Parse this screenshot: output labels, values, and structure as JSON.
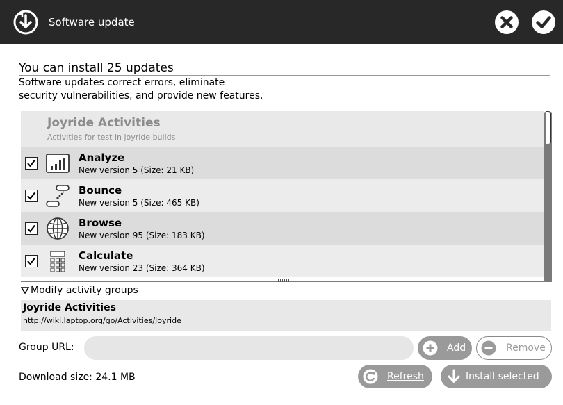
{
  "window": {
    "title": "Software update",
    "app_icon": "download-circle-icon",
    "cancel_icon": "cancel-x-icon",
    "ok_icon": "checkmark-icon"
  },
  "header": {
    "heading": "You can install 25 updates",
    "description_line1": "Software updates correct errors, eliminate",
    "description_line2": "security vulnerabilities, and provide new features."
  },
  "updates": {
    "group": {
      "name": "Joyride Activities",
      "description": "Activities for test in joyride builds"
    },
    "items": [
      {
        "name": "Analyze",
        "version": "New version 5 (Size: 21 KB)",
        "checked": true,
        "icon": "analyze-chart-icon"
      },
      {
        "name": "Bounce",
        "version": "New version 5 (Size: 465 KB)",
        "checked": true,
        "icon": "bounce-icon"
      },
      {
        "name": "Browse",
        "version": "New version 95 (Size: 183 KB)",
        "checked": true,
        "icon": "browse-globe-icon"
      },
      {
        "name": "Calculate",
        "version": "New version 23 (Size: 364 KB)",
        "checked": true,
        "icon": "calculate-icon"
      }
    ]
  },
  "groups": {
    "expander_label": "Modify activity groups",
    "selected_name": "Joyride Activities",
    "selected_url": "http://wiki.laptop.org/go/Activities/Joyride",
    "url_label": "Group URL:",
    "url_value": "",
    "add_label": "Add",
    "remove_label": "Remove"
  },
  "footer": {
    "download_size": "Download size: 24.1 MB",
    "refresh_label": "Refresh",
    "install_label": "Install selected"
  },
  "colors": {
    "titlebar": "#282828",
    "button_gray": "#9a9a9a",
    "row_shade": "#dcdcdc",
    "row_light": "#ececec"
  }
}
